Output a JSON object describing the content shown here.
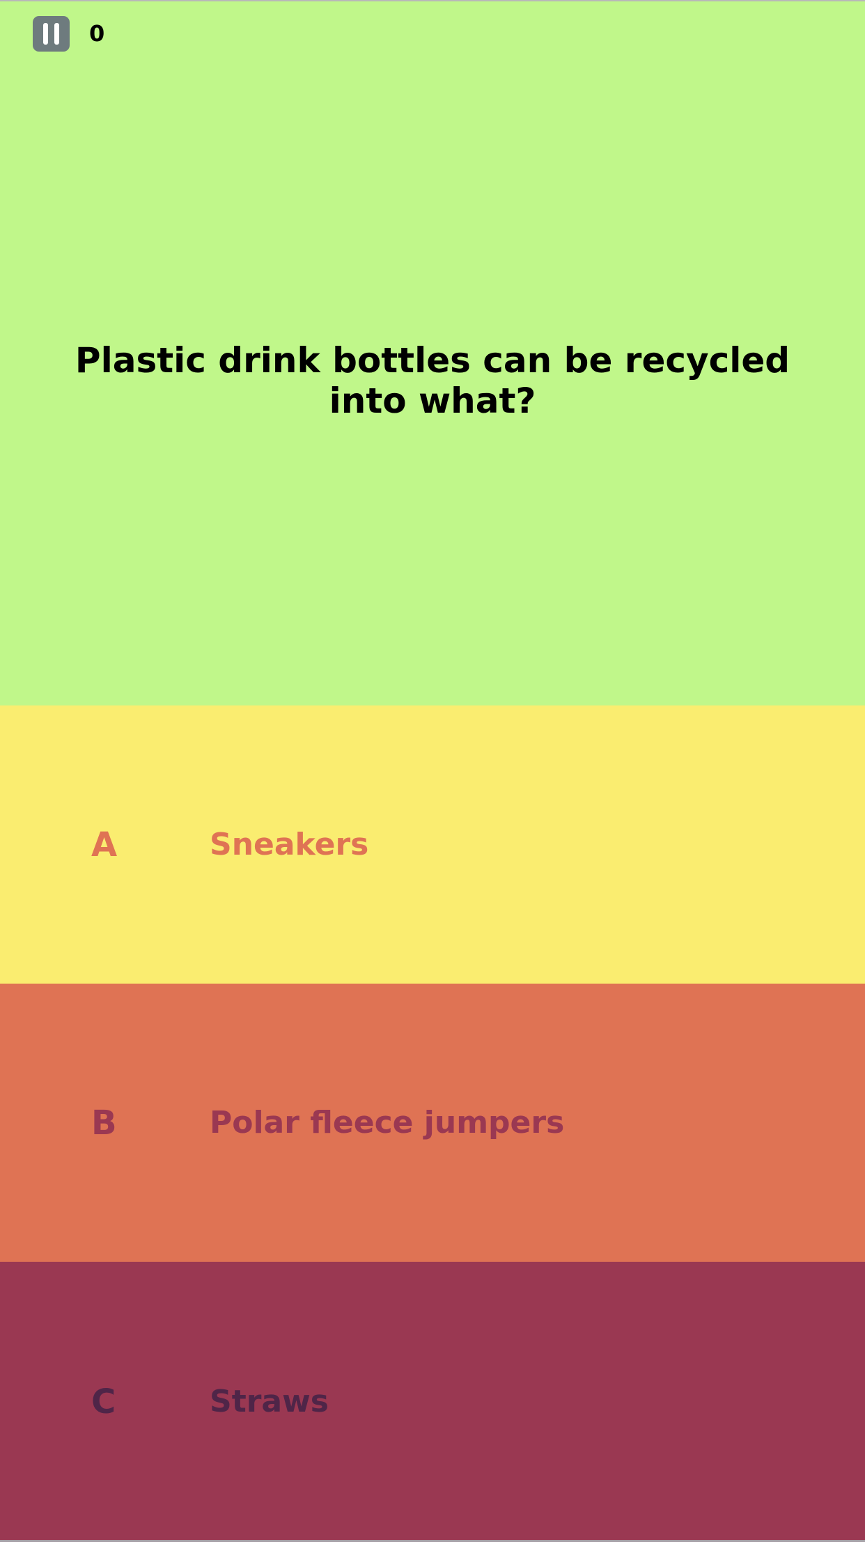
{
  "colors": {
    "question_background": "#c0f78a",
    "score_text": "#000000"
  },
  "hud": {
    "pause_icon": "pause-icon",
    "score": "0"
  },
  "question": {
    "text": "Plastic drink bottles can be recycled into what?"
  },
  "answers": [
    {
      "letter": "A",
      "text": "Sneakers",
      "background": "#faed70",
      "text_color": "#df7354"
    },
    {
      "letter": "B",
      "text": "Polar fleece jumpers",
      "background": "#df7354",
      "text_color": "#9a3852"
    },
    {
      "letter": "C",
      "text": "Straws",
      "background": "#9a3852",
      "text_color": "#4f2548"
    }
  ]
}
